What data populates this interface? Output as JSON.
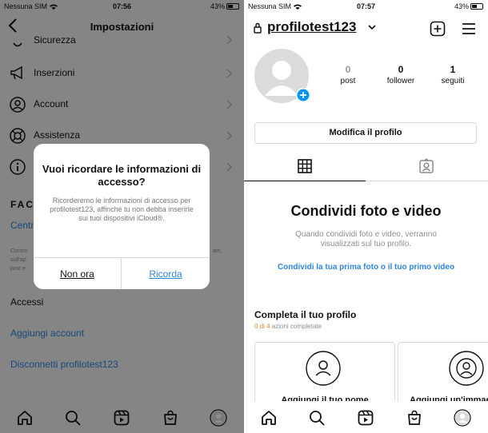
{
  "left": {
    "status": {
      "carrier": "Nessuna SIM",
      "time": "07:56",
      "battery": "43%"
    },
    "header": {
      "title": "Impostazioni"
    },
    "rows": [
      {
        "label": "Sicurezza",
        "icon": "shield-icon"
      },
      {
        "label": "Inserzioni",
        "icon": "megaphone-icon"
      },
      {
        "label": "Account",
        "icon": "account-icon"
      },
      {
        "label": "Assistenza",
        "icon": "lifebuoy-icon"
      },
      {
        "label": "",
        "icon": "info-icon"
      }
    ],
    "facebook_fragment": "FAC",
    "centre_fragment": "Centr",
    "small_text_fragment": [
      "Contro",
      "sull'ap",
      "post e"
    ],
    "small_text_right": [
      "am,",
      ""
    ],
    "accessi": {
      "title": "Accessi",
      "add_account": "Aggiungi account",
      "logout": "Disconnetti profilotest123"
    },
    "alert": {
      "title": "Vuoi ricordare le informazioni di accesso?",
      "message": "Ricorderemo le informazioni di accesso per profilotest123, affinché tu non debba inserirle sui tuoi dispositivi iCloud®.",
      "cancel": "Non ora",
      "confirm": "Ricorda"
    }
  },
  "right": {
    "status": {
      "carrier": "Nessuna SIM",
      "time": "07:57",
      "battery": "43%"
    },
    "username": "profilotest123",
    "stats": [
      {
        "value": "0",
        "label": "post"
      },
      {
        "value": "0",
        "label": "follower"
      },
      {
        "value": "1",
        "label": "seguiti"
      }
    ],
    "edit_profile": "Modifica il profilo",
    "share": {
      "title": "Condividi foto e video",
      "subtitle": "Quando condividi foto e video, verranno visualizzati sul tuo profilo.",
      "link": "Condividi la tua prima foto o il tuo primo video"
    },
    "complete": {
      "title": "Completa il tuo profilo",
      "progress_count": "0 di 4",
      "progress_text": " azioni completate",
      "cards": [
        "Aggiungi il tuo nome",
        "Aggiungi un'immagine"
      ]
    }
  },
  "colors": {
    "link": "#2e86de",
    "accent_orange": "#e8852f"
  }
}
